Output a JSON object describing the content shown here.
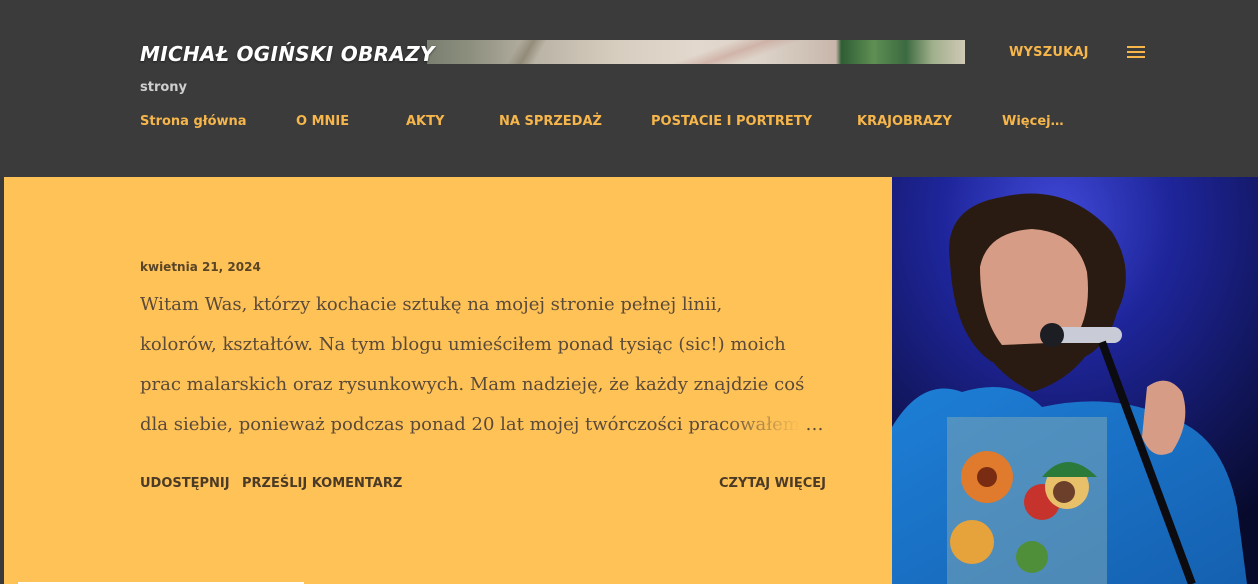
{
  "header": {
    "title": "MICHAŁ OGIŃSKI OBRAZY",
    "subtitle": "strony",
    "search_label": "WYSZUKAJ",
    "menu_icon": "hamburger-menu-icon"
  },
  "nav": {
    "items": [
      {
        "label": "Strona główna"
      },
      {
        "label": "O MNIE"
      },
      {
        "label": "AKTY"
      },
      {
        "label": "NA SPRZEDAŻ"
      },
      {
        "label": "POSTACIE I PORTRETY"
      },
      {
        "label": "KRAJOBRAZY"
      },
      {
        "label": "Więcej…"
      }
    ]
  },
  "post": {
    "date": "kwietnia 21, 2024",
    "lines": [
      " Witam Was, którzy kochacie sztukę na mojej stronie pełnej linii,",
      "kolorów, kształtów. Na tym blogu umieściłem ponad tysiąc (sic!) moich",
      "prac malarskich oraz rysunkowych. Mam nadzieję, że każdy znajdzie coś",
      "dla siebie, ponieważ podczas ponad 20 lat mojej twórczości "
    ],
    "faded_text": "pracowałem",
    "ellipsis": "…",
    "share_label": "UDOSTĘPNIJ",
    "comment_label": "PRZEŚLIJ KOMENTARZ",
    "read_more_label": "CZYTAJ WIĘCEJ"
  },
  "colors": {
    "accent": "#f6b64b",
    "header_bg": "#3b3b3b",
    "card_bg": "#ffc257"
  }
}
